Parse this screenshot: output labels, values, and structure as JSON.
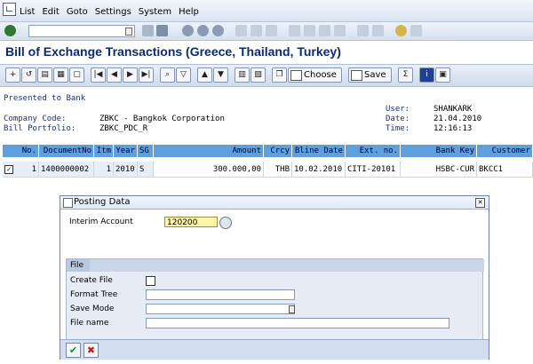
{
  "menu": [
    "List",
    "Edit",
    "Goto",
    "Settings",
    "System",
    "Help"
  ],
  "title": "Bill of Exchange Transactions (Greece, Thailand, Turkey)",
  "app_toolbar": {
    "choose_label": "Choose",
    "save_label": "Save"
  },
  "header": {
    "section_title": "Presented to Bank",
    "company_code_label": "Company Code:",
    "company_code_value": "ZBKC - Bangkok Corporation",
    "portfolio_label": "Bill Portfolio:",
    "portfolio_value": "ZBKC_PDC_R",
    "user_label": "User:",
    "user_value": "SHANKARK",
    "date_label": "Date:",
    "date_value": "21.04.2010",
    "time_label": "Time:",
    "time_value": "12:16:13"
  },
  "table": {
    "headers": [
      "No.",
      "DocumentNo",
      "Itm",
      "Year",
      "SG",
      "Amount",
      "Crcy",
      "Bline Date",
      "Ext. no.",
      "Bank Key",
      "Customer"
    ],
    "rows": [
      {
        "no": "1",
        "doc": "1400000002",
        "itm": "1",
        "year": "2010",
        "sg": "S",
        "amount": "300.000,00",
        "crcy": "THB",
        "bline": "10.02.2010",
        "ext": "CITI-20101",
        "bank": "HSBC-CUR",
        "customer": "BKCC1"
      }
    ]
  },
  "popup": {
    "title": "Posting Data",
    "interim_label": "Interim Account",
    "interim_value": "120200",
    "file_section": "File",
    "create_file_label": "Create File",
    "format_tree_label": "Format Tree",
    "format_tree_value": "",
    "save_mode_label": "Save Mode",
    "save_mode_value": "",
    "file_name_label": "File name",
    "file_name_value": ""
  },
  "colors": {
    "title": "#0d2a6b",
    "table_header": "#5fa0dc",
    "highlight_input": "#fff5a8",
    "ok_green": "#1c8a1c",
    "cancel_red": "#c81818"
  }
}
